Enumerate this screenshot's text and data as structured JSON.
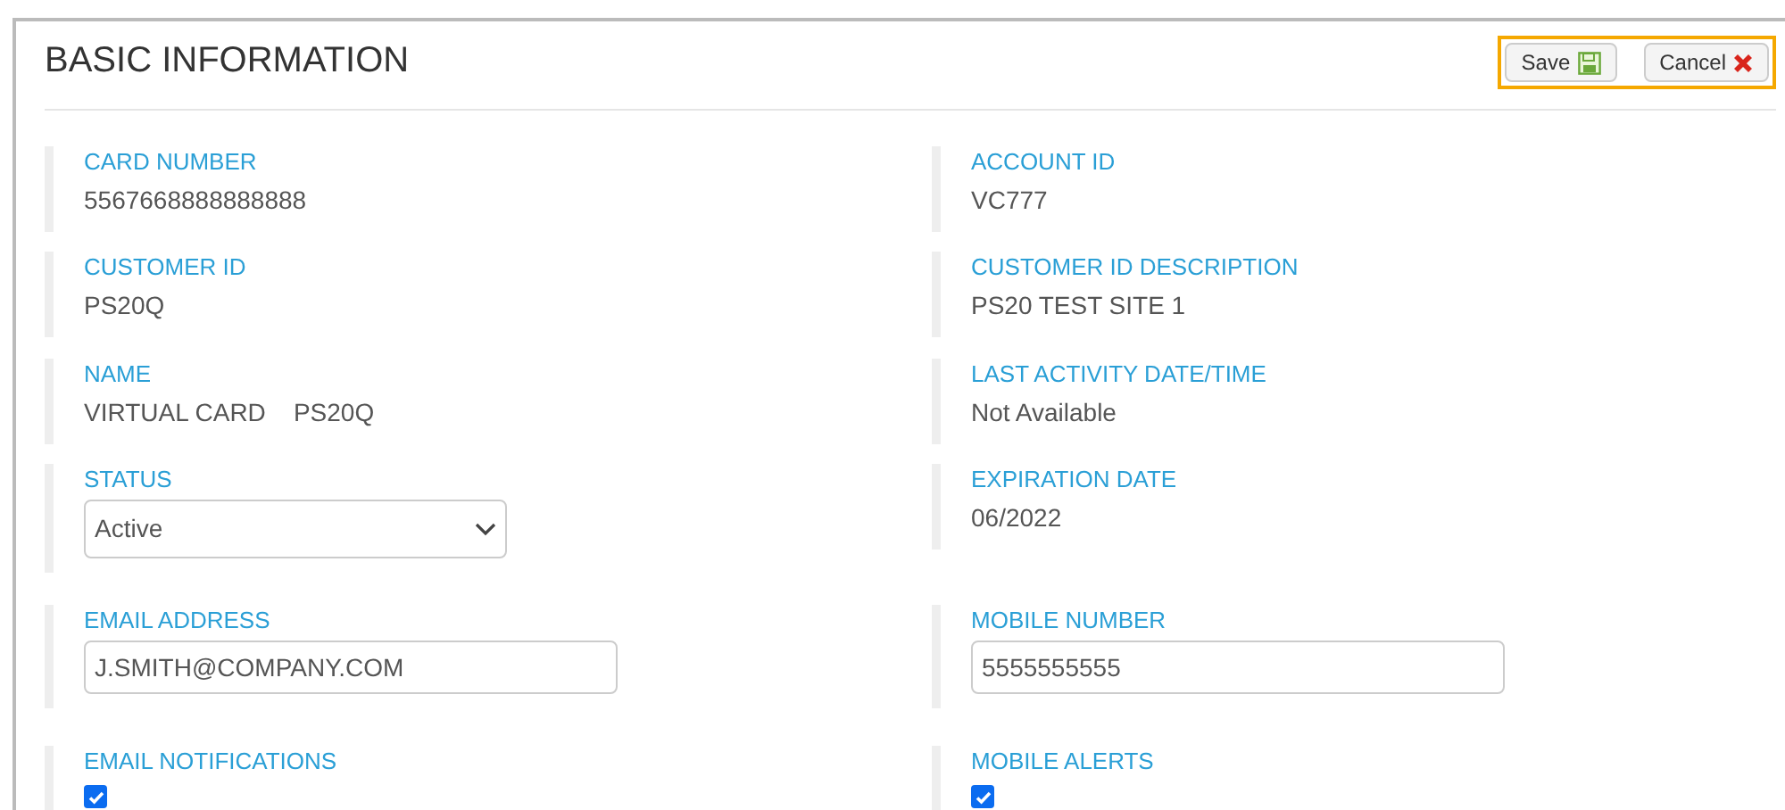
{
  "title": "BASIC INFORMATION",
  "buttons": [
    {
      "label": "Save",
      "kind": "save"
    },
    {
      "label": "Cancel",
      "kind": "cancel"
    }
  ],
  "rows": [
    [
      {
        "label": "CARD NUMBER",
        "kind": "text",
        "value": "5567668888888888"
      },
      {
        "label": "ACCOUNT ID",
        "kind": "text",
        "value": "VC777"
      }
    ],
    [
      {
        "label": "CUSTOMER ID",
        "kind": "text",
        "value": "PS20Q"
      },
      {
        "label": "CUSTOMER ID DESCRIPTION",
        "kind": "text",
        "value": "PS20 TEST SITE 1"
      }
    ],
    [
      {
        "label": "NAME",
        "kind": "text",
        "value": "VIRTUAL CARD    PS20Q"
      },
      {
        "label": "LAST ACTIVITY DATE/TIME",
        "kind": "text",
        "value": "Not Available"
      }
    ],
    [
      {
        "label": "STATUS",
        "kind": "select",
        "value": "Active"
      },
      {
        "label": "EXPIRATION DATE",
        "kind": "text",
        "value": "06/2022"
      }
    ],
    [
      {
        "label": "EMAIL ADDRESS",
        "kind": "input",
        "value": "J.SMITH@COMPANY.COM"
      },
      {
        "label": "MOBILE NUMBER",
        "kind": "input",
        "value": "5555555555"
      }
    ],
    [
      {
        "label": "EMAIL NOTIFICATIONS",
        "kind": "checkbox",
        "checked": true
      },
      {
        "label": "MOBILE ALERTS",
        "kind": "checkbox",
        "checked": true
      }
    ]
  ]
}
